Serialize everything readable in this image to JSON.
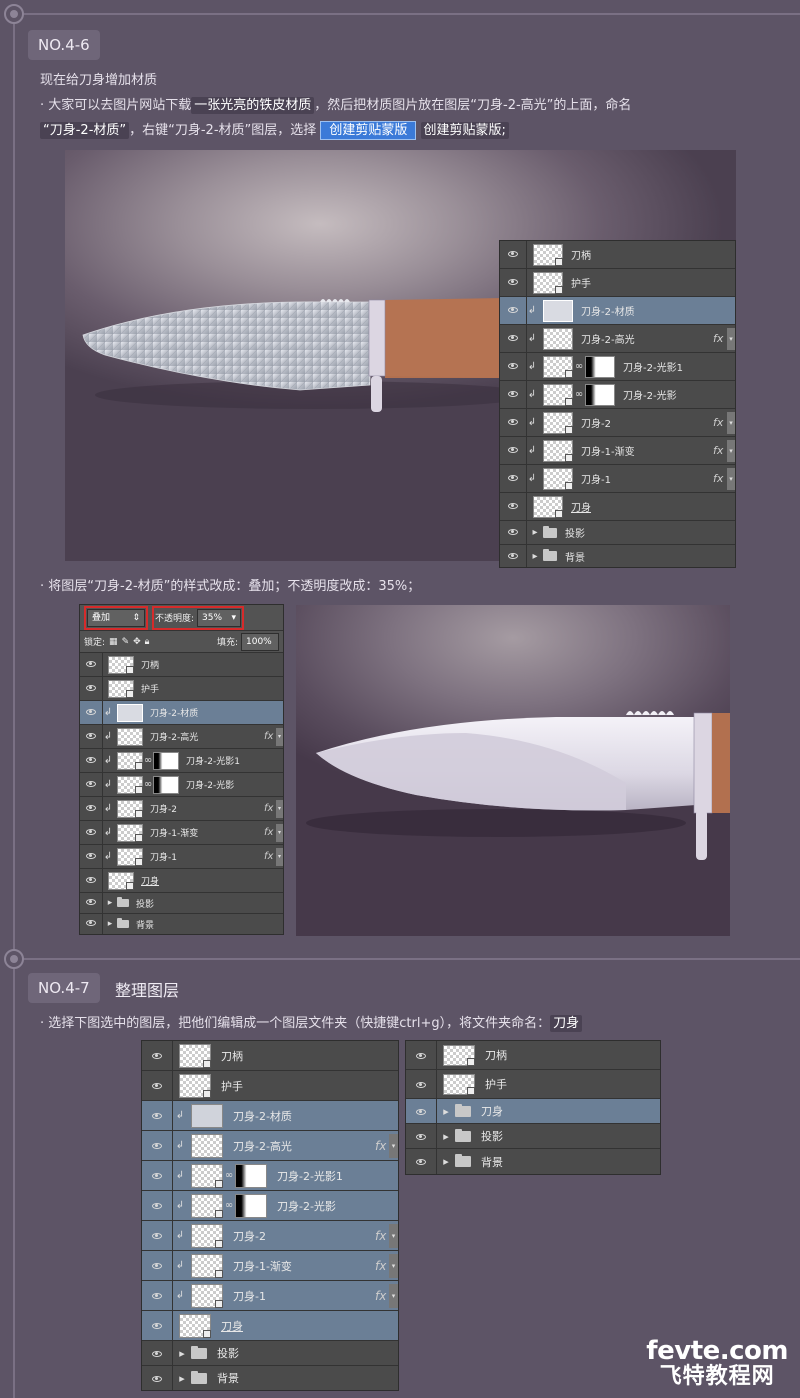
{
  "sec1": {
    "tag": "NO.4-6",
    "intro": "现在给刀身增加材质",
    "line1_a": "· 大家可以去图片网站下载",
    "line1_hl": "一张光亮的铁皮材质",
    "line1_b": "，然后把材质图片放在图层“刀身-2-高光”的上面，命名",
    "line2_hl": "“刀身-2-材质”",
    "line2_a": "，右键“刀身-2-材质”图层，选择",
    "line2_btn": "创建剪贴蒙版",
    "line2_b": "创建剪贴蒙版;",
    "line3": "· 将图层“刀身-2-材质”的样式改成：叠加；不透明度改成：35%；"
  },
  "sec2": {
    "tag": "NO.4-7",
    "title": "整理图层",
    "line1_a": "· 选择下图选中的图层，把他们编辑成一个图层文件夹（快捷键ctrl+g），将文件夹命名：",
    "line1_hl": "刀身"
  },
  "panel1": {
    "layers": [
      {
        "name": "刀柄",
        "type": "normal"
      },
      {
        "name": "护手",
        "type": "normal"
      },
      {
        "name": "刀身-2-材质",
        "type": "clip-texture",
        "selected": true
      },
      {
        "name": "刀身-2-高光",
        "type": "clip",
        "fx": "fx"
      },
      {
        "name": "刀身-2-光影1",
        "type": "clip-mask"
      },
      {
        "name": "刀身-2-光影",
        "type": "clip-mask"
      },
      {
        "name": "刀身-2",
        "type": "clip",
        "fx": "fx"
      },
      {
        "name": "刀身-1-渐变",
        "type": "clip",
        "fx": "fx"
      },
      {
        "name": "刀身-1",
        "type": "clip",
        "fx": "fx"
      },
      {
        "name": "刀身",
        "type": "base"
      },
      {
        "name": "投影",
        "type": "folder"
      },
      {
        "name": "背景",
        "type": "folder"
      }
    ]
  },
  "panel2": {
    "blend_mode": "叠加",
    "opacity_label": "不透明度:",
    "opacity_value": "35%",
    "lock_label": "锁定:",
    "fill_label": "填充:",
    "fill_value": "100%",
    "layers": [
      {
        "name": "刀柄",
        "type": "normal"
      },
      {
        "name": "护手",
        "type": "normal"
      },
      {
        "name": "刀身-2-材质",
        "type": "clip-texture",
        "selected": true
      },
      {
        "name": "刀身-2-高光",
        "type": "clip",
        "fx": "fx"
      },
      {
        "name": "刀身-2-光影1",
        "type": "clip-mask"
      },
      {
        "name": "刀身-2-光影",
        "type": "clip-mask"
      },
      {
        "name": "刀身-2",
        "type": "clip",
        "fx": "fx"
      },
      {
        "name": "刀身-1-渐变",
        "type": "clip",
        "fx": "fx"
      },
      {
        "name": "刀身-1",
        "type": "clip",
        "fx": "fx"
      },
      {
        "name": "刀身",
        "type": "base"
      },
      {
        "name": "投影",
        "type": "folder"
      },
      {
        "name": "背景",
        "type": "folder"
      }
    ]
  },
  "panel3": {
    "layers": [
      {
        "name": "刀柄",
        "type": "normal"
      },
      {
        "name": "护手",
        "type": "normal"
      },
      {
        "name": "刀身-2-材质",
        "type": "clip-texture",
        "selected": true
      },
      {
        "name": "刀身-2-高光",
        "type": "clip",
        "fx": "fx",
        "selected": true
      },
      {
        "name": "刀身-2-光影1",
        "type": "clip-mask",
        "selected": true
      },
      {
        "name": "刀身-2-光影",
        "type": "clip-mask",
        "selected": true
      },
      {
        "name": "刀身-2",
        "type": "clip",
        "fx": "fx",
        "selected": true
      },
      {
        "name": "刀身-1-渐变",
        "type": "clip",
        "fx": "fx",
        "selected": true
      },
      {
        "name": "刀身-1",
        "type": "clip",
        "fx": "fx",
        "selected": true
      },
      {
        "name": "刀身",
        "type": "base",
        "selected": true
      },
      {
        "name": "投影",
        "type": "folder"
      },
      {
        "name": "背景",
        "type": "folder"
      }
    ]
  },
  "panel4": {
    "layers": [
      {
        "name": "刀柄",
        "type": "normal"
      },
      {
        "name": "护手",
        "type": "normal"
      },
      {
        "name": "刀身",
        "type": "folder",
        "selected": true
      },
      {
        "name": "投影",
        "type": "folder"
      },
      {
        "name": "背景",
        "type": "folder"
      }
    ]
  },
  "watermark": {
    "top": "fevte.com",
    "bottom": "飞特教程网"
  }
}
